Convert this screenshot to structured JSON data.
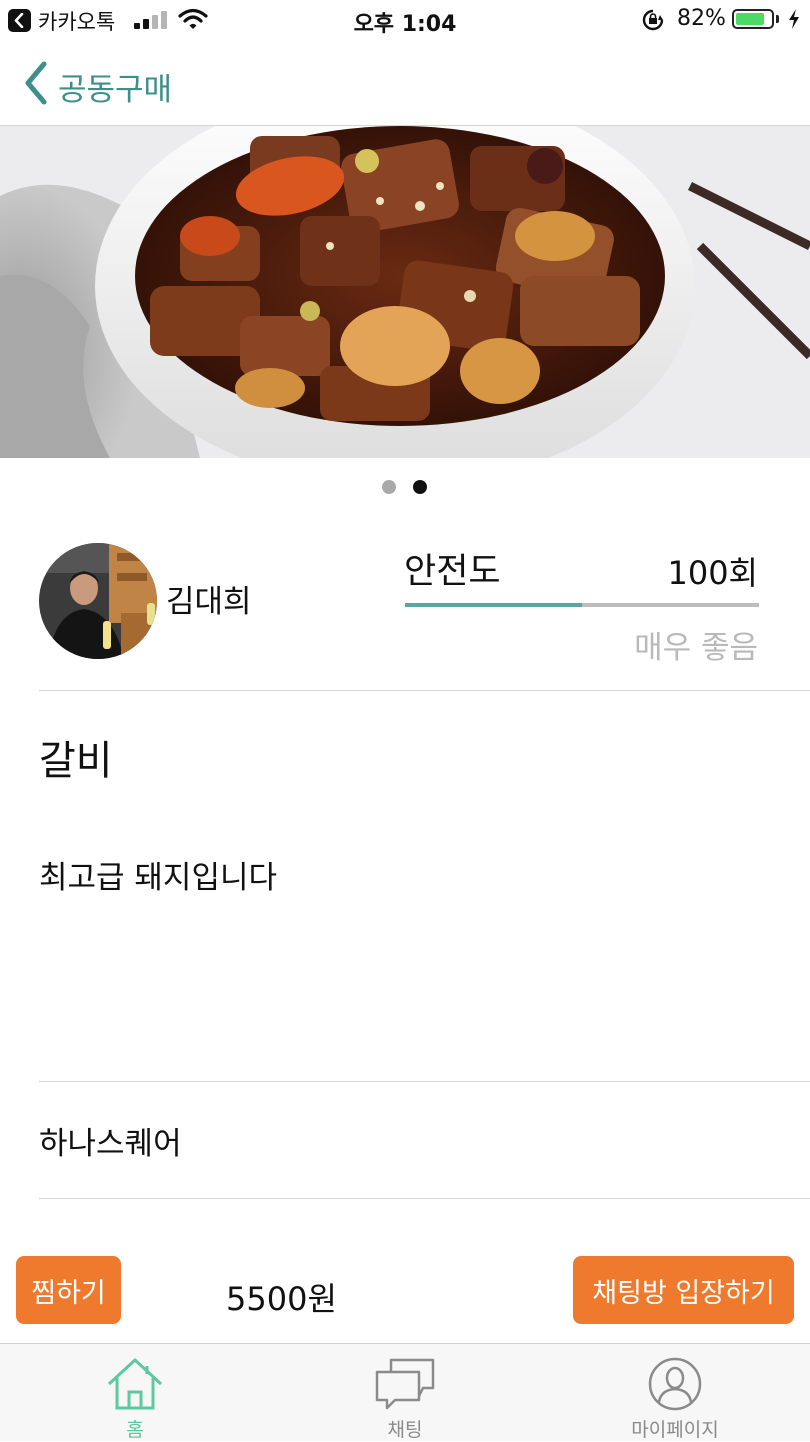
{
  "status_bar": {
    "back_app": "카카오톡",
    "time": "오후 1:04",
    "battery": "82%",
    "battery_level": 0.82
  },
  "nav": {
    "back_label": "공동구매",
    "accent_color": "#3e8f8a"
  },
  "carousel": {
    "image_description_icon": "food-photo",
    "pages": 2,
    "active_page": 2
  },
  "seller": {
    "name": "김대희"
  },
  "safety": {
    "label": "안전도",
    "count": "100회",
    "level": 0.5,
    "grade": "매우 좋음"
  },
  "product": {
    "title": "갈비",
    "description": "최고급 돼지입니다",
    "location": "하나스퀘어"
  },
  "actions": {
    "like_label": "찜하기",
    "price": "5500원",
    "chat_label": "채팅방 입장하기",
    "button_color": "#ef7a2d"
  },
  "tabs": [
    {
      "label": "홈",
      "icon": "home-icon",
      "active": true
    },
    {
      "label": "채팅",
      "icon": "chat-icon",
      "active": false
    },
    {
      "label": "마이페이지",
      "icon": "profile-icon",
      "active": false
    }
  ],
  "colors": {
    "active_tab": "#5cc9a0",
    "inactive_tab": "#8a8a8a"
  }
}
